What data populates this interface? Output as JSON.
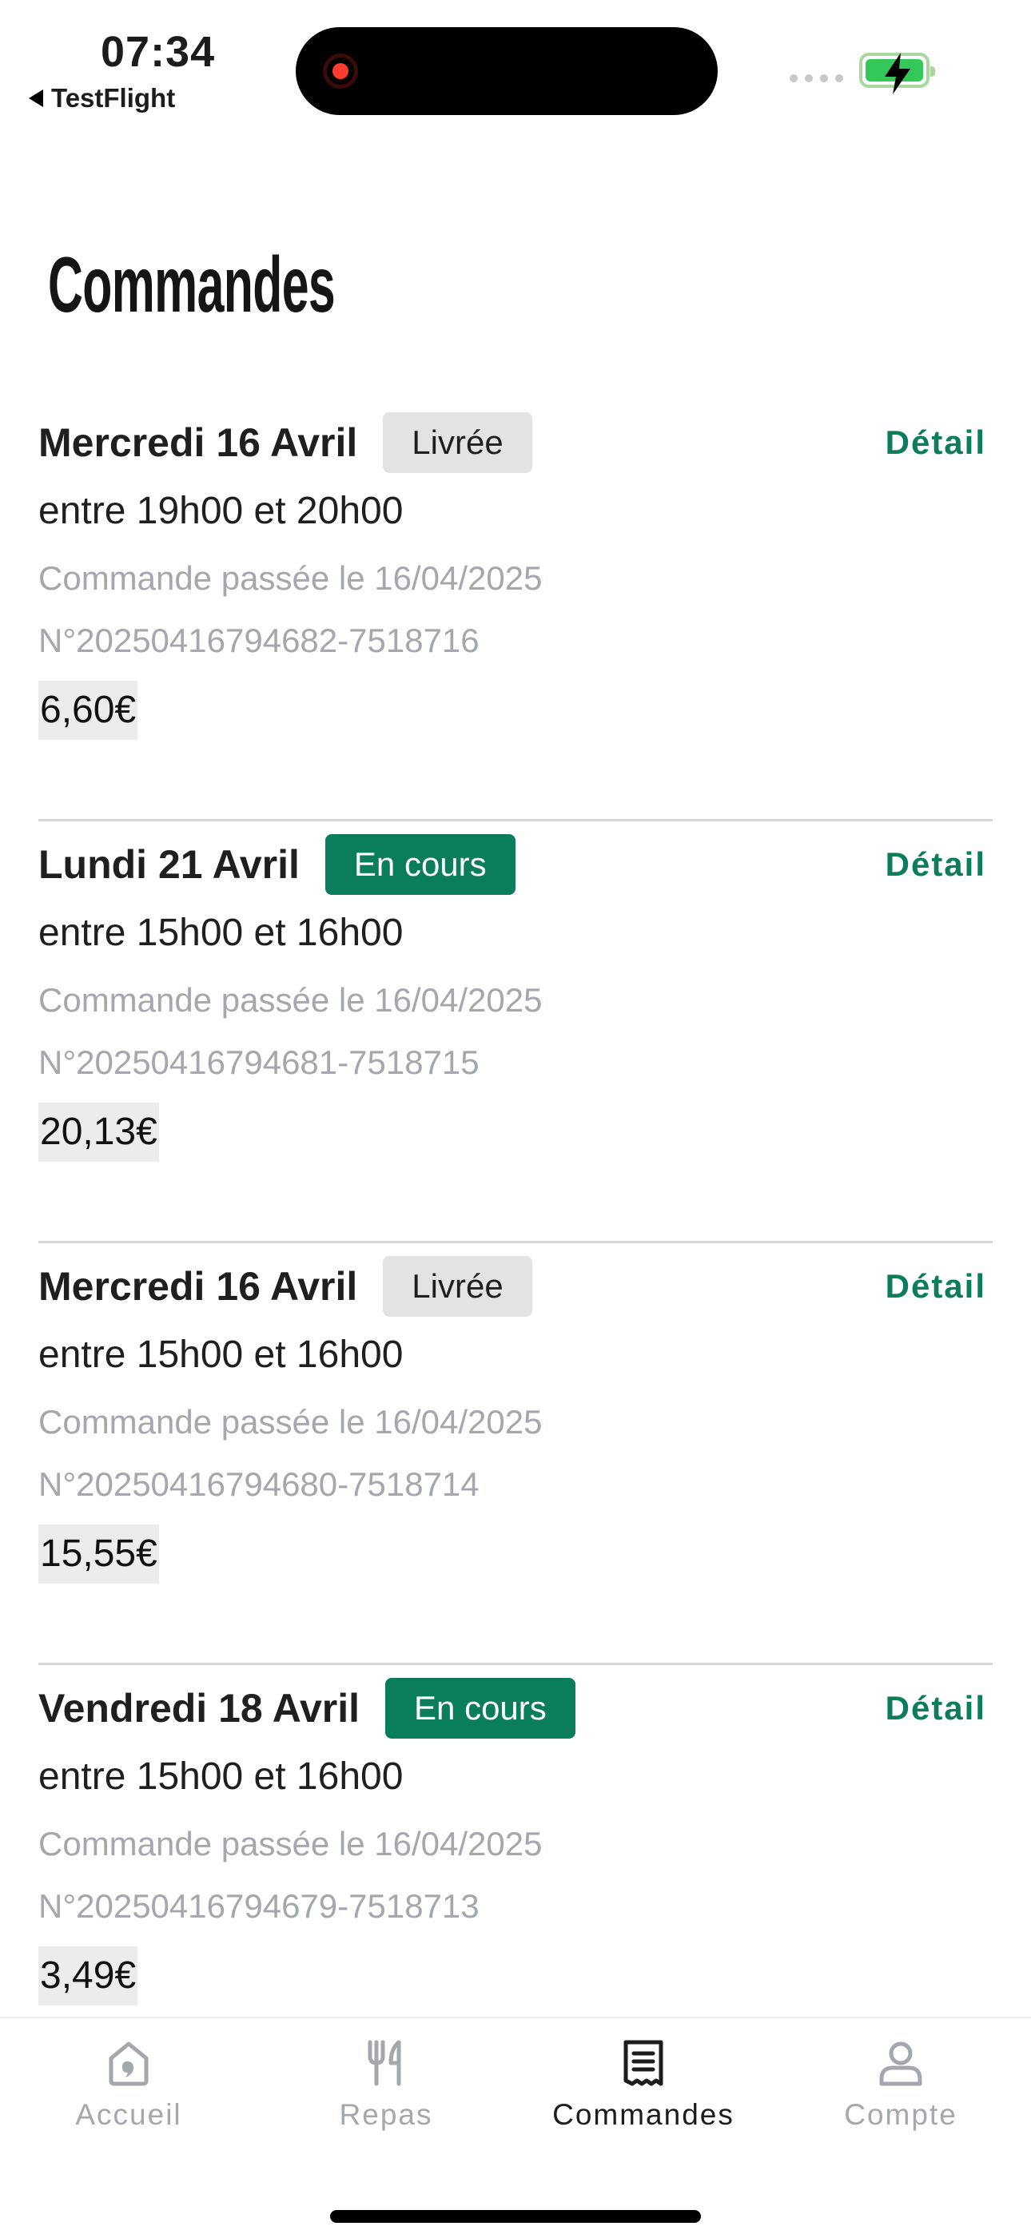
{
  "status_bar": {
    "time": "07:34",
    "back_app": "TestFlight"
  },
  "page": {
    "title": "Commandes"
  },
  "orders": [
    {
      "date": "Mercredi 16 Avril",
      "status": "Livrée",
      "status_kind": "delivered",
      "slot": "entre 19h00 et 20h00",
      "placed": "Commande passée le 16/04/2025",
      "number": "N°20250416794682-7518716",
      "price": "6,60€",
      "detail_label": "Détail"
    },
    {
      "date": "Lundi 21 Avril",
      "status": "En cours",
      "status_kind": "progress",
      "slot": "entre 15h00 et 16h00",
      "placed": "Commande passée le 16/04/2025",
      "number": "N°20250416794681-7518715",
      "price": "20,13€",
      "detail_label": "Détail"
    },
    {
      "date": "Mercredi 16 Avril",
      "status": "Livrée",
      "status_kind": "delivered",
      "slot": "entre 15h00 et 16h00",
      "placed": "Commande passée le 16/04/2025",
      "number": "N°20250416794680-7518714",
      "price": "15,55€",
      "detail_label": "Détail"
    },
    {
      "date": "Vendredi 18 Avril",
      "status": "En cours",
      "status_kind": "progress",
      "slot": "entre 15h00 et 16h00",
      "placed": "Commande passée le 16/04/2025",
      "number": "N°20250416794679-7518713",
      "price": "3,49€",
      "detail_label": "Détail"
    }
  ],
  "tabbar": {
    "tabs": [
      {
        "label": "Accueil",
        "icon": "home-icon",
        "active": false
      },
      {
        "label": "Repas",
        "icon": "cutlery-icon",
        "active": false
      },
      {
        "label": "Commandes",
        "icon": "receipt-icon",
        "active": true
      },
      {
        "label": "Compte",
        "icon": "person-icon",
        "active": false
      }
    ]
  },
  "colors": {
    "accent_green": "#0a7d5b",
    "muted_text": "#a4a7ae",
    "delivered_badge_bg": "#e3e3e5"
  }
}
